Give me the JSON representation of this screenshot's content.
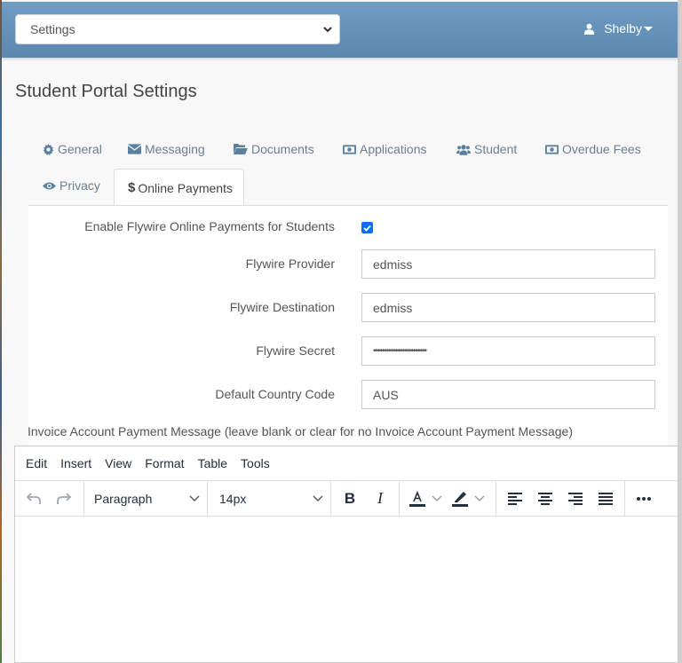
{
  "navbar": {
    "context_select": "Settings",
    "user_name": "Shelby"
  },
  "page": {
    "title": "Student Portal Settings"
  },
  "tabs": [
    {
      "label": "General",
      "icon": "gear-icon"
    },
    {
      "label": "Messaging",
      "icon": "envelope-icon"
    },
    {
      "label": "Documents",
      "icon": "folder-open-icon"
    },
    {
      "label": "Applications",
      "icon": "money-bill-icon"
    },
    {
      "label": "Student",
      "icon": "users-icon"
    },
    {
      "label": "Overdue Fees",
      "icon": "money-bill-icon"
    },
    {
      "label": "Privacy",
      "icon": "eye-icon"
    },
    {
      "label": "Online Payments",
      "icon": "dollar-icon",
      "active": true
    }
  ],
  "form": {
    "enable_label": "Enable Flywire Online Payments for Students",
    "enable_checked": true,
    "provider_label": "Flywire Provider",
    "provider_value": "edmiss",
    "destination_label": "Flywire Destination",
    "destination_value": "edmiss",
    "secret_label": "Flywire Secret",
    "secret_value": "••••••••••••••••••••••••",
    "country_label": "Default Country Code",
    "country_value": "AUS",
    "invoice_label": "Invoice Account Payment Message (leave blank or clear for no Invoice Account Payment Message)"
  },
  "editor": {
    "menu": [
      "Edit",
      "Insert",
      "View",
      "Format",
      "Table",
      "Tools"
    ],
    "block_format": "Paragraph",
    "font_size": "14px",
    "content": ""
  },
  "colors": {
    "navbar": "#6a96bd",
    "accent_checkbox": "#0d6efd",
    "tab_text": "#6b7f8e"
  }
}
